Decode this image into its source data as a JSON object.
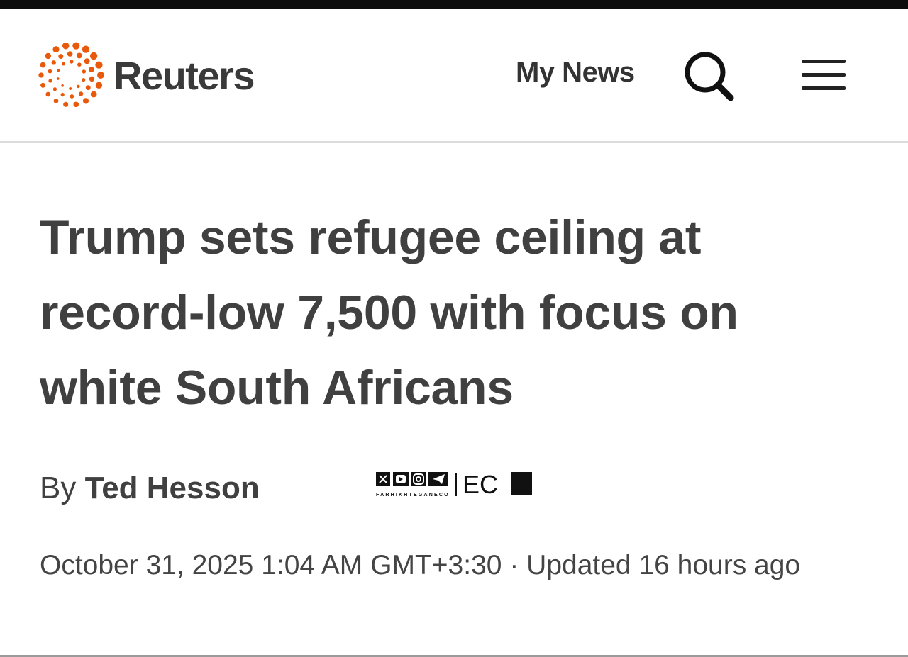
{
  "header": {
    "brand_name": "Reuters",
    "my_news_label": "My News",
    "search_icon": "search-icon",
    "menu_icon": "hamburger-menu-icon",
    "brand_color": "#e8590c"
  },
  "article": {
    "headline": "Trump sets refugee ceiling at record-low 7,500 with focus on white South Africans",
    "byline_prefix": "By",
    "author": "Ted Hesson",
    "date": "October 31, 2025 1:04 AM GMT+3:30",
    "separator": "·",
    "updated": "Updated 16 hours ago"
  },
  "watermark": {
    "handle": "FARHIKHTEGANECO",
    "logo_text": "EC",
    "icons": [
      "x-icon",
      "youtube-icon",
      "instagram-icon",
      "telegram-icon"
    ]
  }
}
